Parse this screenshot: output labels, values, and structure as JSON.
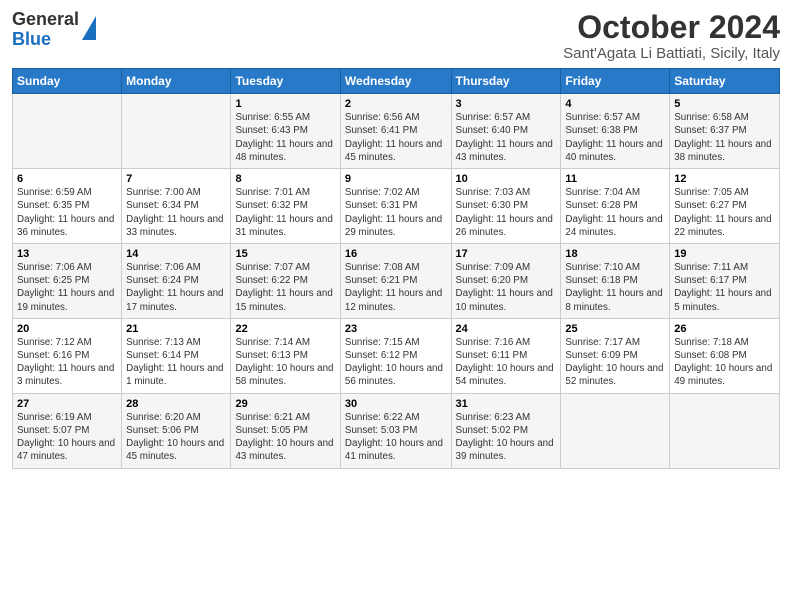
{
  "logo": {
    "line1": "General",
    "line2": "Blue"
  },
  "title": "October 2024",
  "subtitle": "Sant'Agata Li Battiati, Sicily, Italy",
  "days_of_week": [
    "Sunday",
    "Monday",
    "Tuesday",
    "Wednesday",
    "Thursday",
    "Friday",
    "Saturday"
  ],
  "weeks": [
    [
      {
        "day": "",
        "info": ""
      },
      {
        "day": "",
        "info": ""
      },
      {
        "day": "1",
        "info": "Sunrise: 6:55 AM\nSunset: 6:43 PM\nDaylight: 11 hours and 48 minutes."
      },
      {
        "day": "2",
        "info": "Sunrise: 6:56 AM\nSunset: 6:41 PM\nDaylight: 11 hours and 45 minutes."
      },
      {
        "day": "3",
        "info": "Sunrise: 6:57 AM\nSunset: 6:40 PM\nDaylight: 11 hours and 43 minutes."
      },
      {
        "day": "4",
        "info": "Sunrise: 6:57 AM\nSunset: 6:38 PM\nDaylight: 11 hours and 40 minutes."
      },
      {
        "day": "5",
        "info": "Sunrise: 6:58 AM\nSunset: 6:37 PM\nDaylight: 11 hours and 38 minutes."
      }
    ],
    [
      {
        "day": "6",
        "info": "Sunrise: 6:59 AM\nSunset: 6:35 PM\nDaylight: 11 hours and 36 minutes."
      },
      {
        "day": "7",
        "info": "Sunrise: 7:00 AM\nSunset: 6:34 PM\nDaylight: 11 hours and 33 minutes."
      },
      {
        "day": "8",
        "info": "Sunrise: 7:01 AM\nSunset: 6:32 PM\nDaylight: 11 hours and 31 minutes."
      },
      {
        "day": "9",
        "info": "Sunrise: 7:02 AM\nSunset: 6:31 PM\nDaylight: 11 hours and 29 minutes."
      },
      {
        "day": "10",
        "info": "Sunrise: 7:03 AM\nSunset: 6:30 PM\nDaylight: 11 hours and 26 minutes."
      },
      {
        "day": "11",
        "info": "Sunrise: 7:04 AM\nSunset: 6:28 PM\nDaylight: 11 hours and 24 minutes."
      },
      {
        "day": "12",
        "info": "Sunrise: 7:05 AM\nSunset: 6:27 PM\nDaylight: 11 hours and 22 minutes."
      }
    ],
    [
      {
        "day": "13",
        "info": "Sunrise: 7:06 AM\nSunset: 6:25 PM\nDaylight: 11 hours and 19 minutes."
      },
      {
        "day": "14",
        "info": "Sunrise: 7:06 AM\nSunset: 6:24 PM\nDaylight: 11 hours and 17 minutes."
      },
      {
        "day": "15",
        "info": "Sunrise: 7:07 AM\nSunset: 6:22 PM\nDaylight: 11 hours and 15 minutes."
      },
      {
        "day": "16",
        "info": "Sunrise: 7:08 AM\nSunset: 6:21 PM\nDaylight: 11 hours and 12 minutes."
      },
      {
        "day": "17",
        "info": "Sunrise: 7:09 AM\nSunset: 6:20 PM\nDaylight: 11 hours and 10 minutes."
      },
      {
        "day": "18",
        "info": "Sunrise: 7:10 AM\nSunset: 6:18 PM\nDaylight: 11 hours and 8 minutes."
      },
      {
        "day": "19",
        "info": "Sunrise: 7:11 AM\nSunset: 6:17 PM\nDaylight: 11 hours and 5 minutes."
      }
    ],
    [
      {
        "day": "20",
        "info": "Sunrise: 7:12 AM\nSunset: 6:16 PM\nDaylight: 11 hours and 3 minutes."
      },
      {
        "day": "21",
        "info": "Sunrise: 7:13 AM\nSunset: 6:14 PM\nDaylight: 11 hours and 1 minute."
      },
      {
        "day": "22",
        "info": "Sunrise: 7:14 AM\nSunset: 6:13 PM\nDaylight: 10 hours and 58 minutes."
      },
      {
        "day": "23",
        "info": "Sunrise: 7:15 AM\nSunset: 6:12 PM\nDaylight: 10 hours and 56 minutes."
      },
      {
        "day": "24",
        "info": "Sunrise: 7:16 AM\nSunset: 6:11 PM\nDaylight: 10 hours and 54 minutes."
      },
      {
        "day": "25",
        "info": "Sunrise: 7:17 AM\nSunset: 6:09 PM\nDaylight: 10 hours and 52 minutes."
      },
      {
        "day": "26",
        "info": "Sunrise: 7:18 AM\nSunset: 6:08 PM\nDaylight: 10 hours and 49 minutes."
      }
    ],
    [
      {
        "day": "27",
        "info": "Sunrise: 6:19 AM\nSunset: 5:07 PM\nDaylight: 10 hours and 47 minutes."
      },
      {
        "day": "28",
        "info": "Sunrise: 6:20 AM\nSunset: 5:06 PM\nDaylight: 10 hours and 45 minutes."
      },
      {
        "day": "29",
        "info": "Sunrise: 6:21 AM\nSunset: 5:05 PM\nDaylight: 10 hours and 43 minutes."
      },
      {
        "day": "30",
        "info": "Sunrise: 6:22 AM\nSunset: 5:03 PM\nDaylight: 10 hours and 41 minutes."
      },
      {
        "day": "31",
        "info": "Sunrise: 6:23 AM\nSunset: 5:02 PM\nDaylight: 10 hours and 39 minutes."
      },
      {
        "day": "",
        "info": ""
      },
      {
        "day": "",
        "info": ""
      }
    ]
  ]
}
